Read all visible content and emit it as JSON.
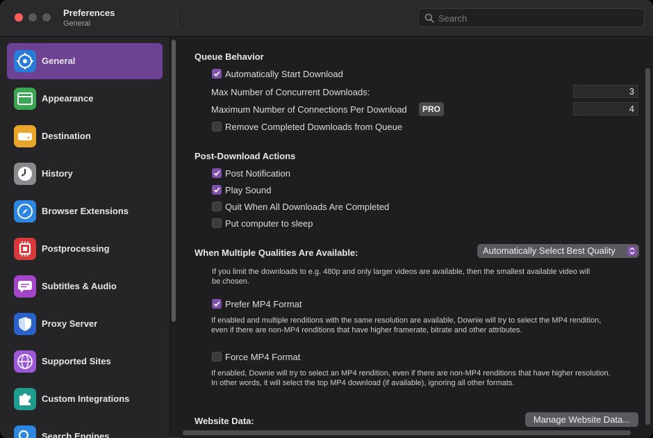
{
  "window": {
    "title": "Preferences",
    "subtitle": "General"
  },
  "search": {
    "placeholder": "Search"
  },
  "sidebar": {
    "items": [
      {
        "label": "General",
        "icon": "gear-icon",
        "color": "#2a7bd6",
        "active": true
      },
      {
        "label": "Appearance",
        "icon": "window-icon",
        "color": "#3aa653"
      },
      {
        "label": "Destination",
        "icon": "drive-icon",
        "color": "#e8a72c"
      },
      {
        "label": "History",
        "icon": "clock-icon",
        "color": "#8a8a8e"
      },
      {
        "label": "Browser Extensions",
        "icon": "compass-icon",
        "color": "#2d87e0"
      },
      {
        "label": "Postprocessing",
        "icon": "chip-icon",
        "color": "#d63a3a"
      },
      {
        "label": "Subtitles & Audio",
        "icon": "speech-bubble-icon",
        "color": "#a545c9"
      },
      {
        "label": "Proxy Server",
        "icon": "shield-icon",
        "color": "#2a62c9"
      },
      {
        "label": "Supported Sites",
        "icon": "globe-icon",
        "color": "#9b58d6"
      },
      {
        "label": "Custom Integrations",
        "icon": "puzzle-icon",
        "color": "#1f9c8e"
      },
      {
        "label": "Search Engines",
        "icon": "magnifier-icon",
        "color": "#2d87e0"
      }
    ]
  },
  "queue": {
    "heading": "Queue Behavior",
    "auto_start": {
      "label": "Automatically Start Download",
      "checked": true
    },
    "max_concurrent": {
      "label": "Max Number of Concurrent Downloads:",
      "value": "3"
    },
    "max_connections": {
      "label": "Maximum Number of Connections Per Download",
      "badge": "PRO",
      "value": "4"
    },
    "remove_completed": {
      "label": "Remove Completed Downloads from Queue",
      "checked": false
    }
  },
  "post": {
    "heading": "Post-Download Actions",
    "notification": {
      "label": "Post Notification",
      "checked": true
    },
    "sound": {
      "label": "Play Sound",
      "checked": true
    },
    "quit": {
      "label": "Quit When All Downloads Are Completed",
      "checked": false
    },
    "sleep": {
      "label": "Put computer to sleep",
      "checked": false
    }
  },
  "quality": {
    "heading": "When Multiple Qualities Are Available:",
    "selected": "Automatically Select Best Quality",
    "help_line1": "If you limit the downloads to e.g. 480p and only larger videos are available, then the smallest available video will",
    "help_line2": "be chosen.",
    "prefer_mp4": {
      "label": "Prefer MP4 Format",
      "checked": true
    },
    "prefer_help_line1": "If enabled and multiple renditions with the same resolution are available, Downie will try to select the MP4 rendition,",
    "prefer_help_line2": "even if there are non-MP4 renditions that have higher framerate, bitrate and other attributes.",
    "force_mp4": {
      "label": "Force MP4 Format",
      "checked": false
    },
    "force_help_line1": "If enabled, Downie will try to select an MP4 rendition, even if there are non-MP4 renditions that have higher resolution.",
    "force_help_line2": "In other words, it will select the top MP4 download (if available), ignoring all other formats."
  },
  "website": {
    "heading": "Website Data:",
    "button": "Manage Website Data..."
  },
  "colors": {
    "accent": "#7e50a8",
    "sidebar_active": "#6d4193"
  }
}
